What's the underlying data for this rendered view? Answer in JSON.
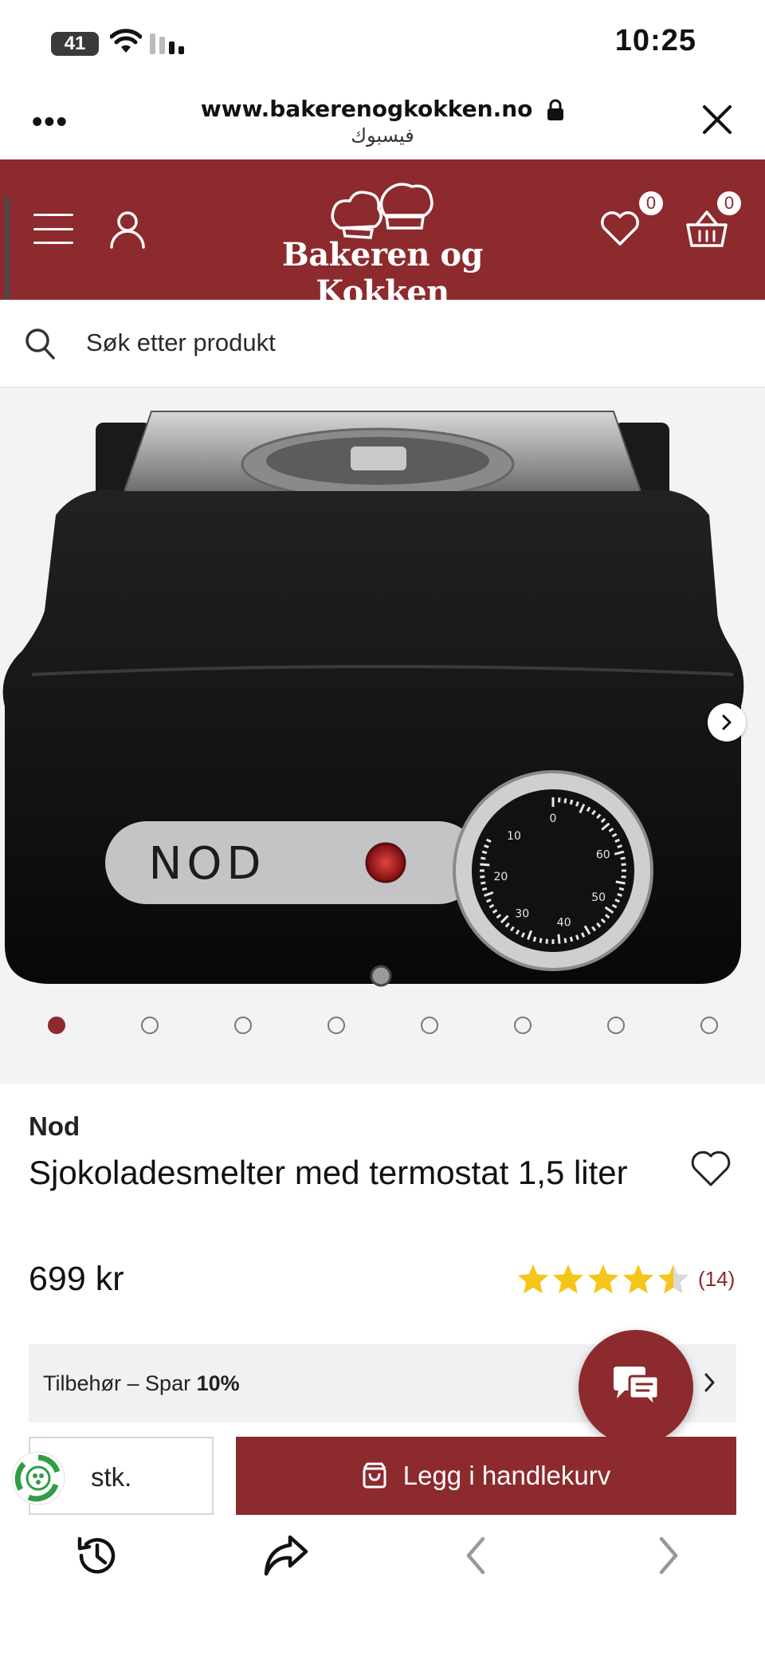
{
  "status_bar": {
    "battery": "41",
    "time": "10:25"
  },
  "browser": {
    "menu_dots": "•••",
    "url": "www.bakerenogkokken.no",
    "subtitle": "فيسبوك"
  },
  "header": {
    "logo_text": "Bakeren og Kokken",
    "wishlist_count": "0",
    "cart_count": "0"
  },
  "search": {
    "placeholder": "Søk etter produkt"
  },
  "gallery": {
    "dot_count": 8,
    "active_index": 0,
    "dial_numbers": [
      "0",
      "10",
      "20",
      "30",
      "40",
      "50",
      "60"
    ],
    "brand_plate": "NOD"
  },
  "product": {
    "brand": "Nod",
    "title": "Sjokoladesmelter med termostat 1,5 liter",
    "price": "699 kr",
    "rating": 4.5,
    "review_count": "(14)"
  },
  "accessory": {
    "text": "Tilbehør – Spar ",
    "highlight": "10%"
  },
  "cart_row": {
    "qty_label": "stk.",
    "add_to_cart": "Legg i handlekurv"
  },
  "colors": {
    "brand": "#8c2a2d",
    "star": "#f5c518",
    "gallery_bg": "#f3f3f4"
  }
}
